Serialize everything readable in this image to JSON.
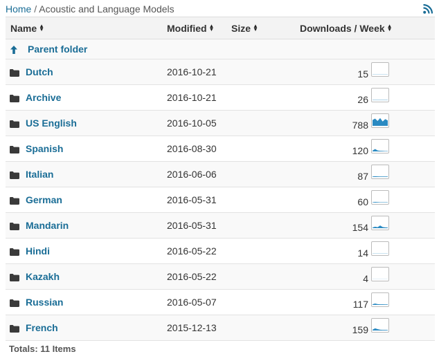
{
  "breadcrumb": {
    "home_label": "Home",
    "separator": "/",
    "current": "Acoustic and Language Models"
  },
  "rss_icon": "rss-feed-icon",
  "table": {
    "headers": {
      "name": "Name",
      "modified": "Modified",
      "size": "Size",
      "downloads": "Downloads / Week"
    },
    "parent_folder_label": "Parent folder",
    "rows": [
      {
        "name": "Dutch",
        "modified": "2016-10-21",
        "size": "",
        "downloads": "15",
        "weekly_trend": [
          0.02,
          0.02,
          0.02,
          0.02,
          0.02,
          0.02,
          0.02
        ]
      },
      {
        "name": "Archive",
        "modified": "2016-10-21",
        "size": "",
        "downloads": "26",
        "weekly_trend": [
          0.03,
          0.03,
          0.03,
          0.03,
          0.03,
          0.03,
          0.03
        ]
      },
      {
        "name": "US English",
        "modified": "2016-10-05",
        "size": "",
        "downloads": "788",
        "weekly_trend": [
          0.6,
          0.75,
          0.5,
          0.8,
          0.45,
          0.7,
          0.55
        ]
      },
      {
        "name": "Spanish",
        "modified": "2016-08-30",
        "size": "",
        "downloads": "120",
        "weekly_trend": [
          0.08,
          0.25,
          0.1,
          0.06,
          0.05,
          0.04,
          0.04
        ]
      },
      {
        "name": "Italian",
        "modified": "2016-06-06",
        "size": "",
        "downloads": "87",
        "weekly_trend": [
          0.05,
          0.08,
          0.06,
          0.05,
          0.05,
          0.05,
          0.05
        ]
      },
      {
        "name": "German",
        "modified": "2016-05-31",
        "size": "",
        "downloads": "60",
        "weekly_trend": [
          0.04,
          0.07,
          0.05,
          0.04,
          0.04,
          0.04,
          0.04
        ]
      },
      {
        "name": "Mandarin",
        "modified": "2016-05-31",
        "size": "",
        "downloads": "154",
        "weekly_trend": [
          0.06,
          0.15,
          0.1,
          0.28,
          0.12,
          0.08,
          0.06
        ]
      },
      {
        "name": "Hindi",
        "modified": "2016-05-22",
        "size": "",
        "downloads": "14",
        "weekly_trend": [
          0.02,
          0.02,
          0.02,
          0.02,
          0.02,
          0.02,
          0.02
        ]
      },
      {
        "name": "Kazakh",
        "modified": "2016-05-22",
        "size": "",
        "downloads": "4",
        "weekly_trend": [
          0.01,
          0.01,
          0.01,
          0.01,
          0.01,
          0.01,
          0.01
        ]
      },
      {
        "name": "Russian",
        "modified": "2016-05-07",
        "size": "",
        "downloads": "117",
        "weekly_trend": [
          0.06,
          0.14,
          0.08,
          0.06,
          0.06,
          0.05,
          0.05
        ]
      },
      {
        "name": "French",
        "modified": "2015-12-13",
        "size": "",
        "downloads": "159",
        "weekly_trend": [
          0.08,
          0.22,
          0.14,
          0.08,
          0.06,
          0.06,
          0.05
        ]
      }
    ]
  },
  "totals_label": "Totals: 11 Items",
  "colors": {
    "link": "#1a6d96",
    "sparkline": "#2a8ac2",
    "rss": "#1a6d96"
  }
}
